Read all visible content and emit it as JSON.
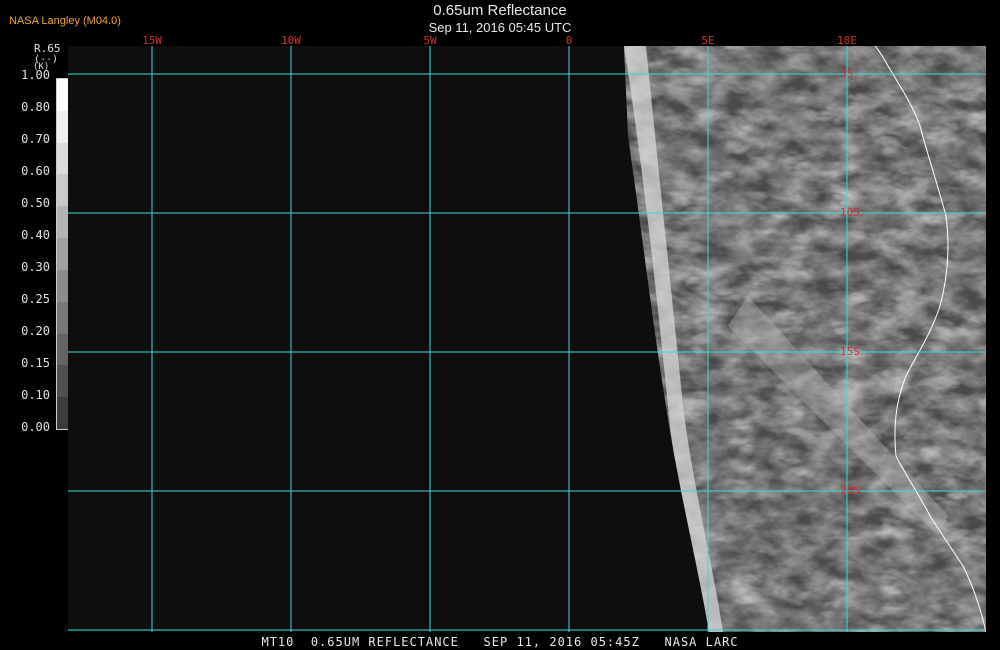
{
  "header": {
    "agency": "NASA Langley (M04.0)",
    "title": "0.65um Reflectance",
    "subtitle": "Sep 11, 2016 05:45 UTC"
  },
  "footer": {
    "text": "MT10  0.65UM REFLECTANCE   SEP 11, 2016 05:45Z   NASA LARC"
  },
  "scale": {
    "name": "R.65",
    "unit": "(--)",
    "k_label": "(K)",
    "ticks": [
      "1.00",
      "0.80",
      "0.70",
      "0.60",
      "0.50",
      "0.40",
      "0.30",
      "0.25",
      "0.20",
      "0.15",
      "0.10",
      "0.00"
    ]
  },
  "map": {
    "longitude_labels": [
      "15W",
      "10W",
      "5W",
      "0",
      "5E",
      "10E"
    ],
    "latitude_labels": [
      "5S",
      "10S",
      "15S",
      "20S"
    ],
    "colors": {
      "grid": "#40d8d8",
      "labels": "#d23232",
      "coast": "#ffffff",
      "background": "#0e0e0e"
    }
  }
}
